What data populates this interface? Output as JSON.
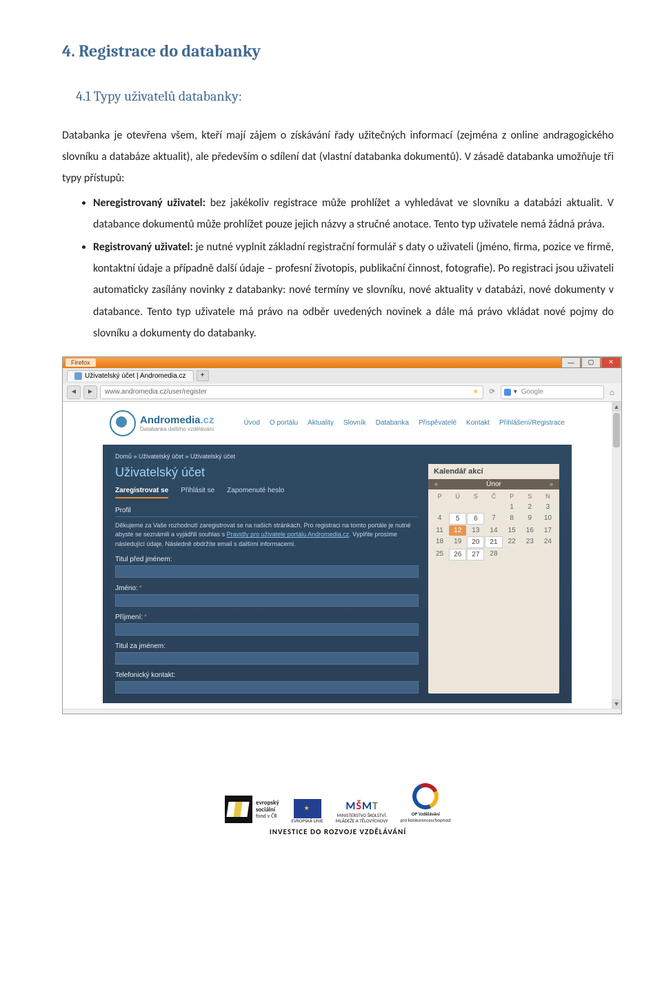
{
  "doc": {
    "h1": "4. Registrace do databanky",
    "h2": "4.1 Typy uživatelů databanky:",
    "intro": "Databanka je otevřena všem, kteří mají zájem o získávání řady užitečných informací (zejména z online andragogického slovníku a databáze aktualit), ale především o sdílení dat (vlastní databanka dokumentů). V zásadě databanka umožňuje tři typy přístupů:",
    "bullets": [
      {
        "bold": "Neregistrovaný uživatel:",
        "text": " bez jakékoliv registrace může prohlížet a vyhledávat ve slovníku a databázi aktualit. V databance dokumentů může prohlížet pouze jejich názvy a stručné anotace. Tento typ uživatele nemá žádná práva."
      },
      {
        "bold": "Registrovaný uživatel:",
        "text": " je nutné vyplnit základní registrační formulář s daty o uživateli (jméno, firma, pozice ve firmě, kontaktní údaje a případně další údaje – profesní životopis, publikační činnost, fotografie). Po registraci jsou uživateli automaticky zasílány novinky z databanky: nové termíny ve slovníku, nové aktuality v databázi, nové dokumenty v databance. Tento typ uživatele má právo na odběr uvedených novinek a dále má právo vkládat nové pojmy do slovníku a dokumenty do databanky."
      }
    ]
  },
  "win": {
    "firefox": "Firefox",
    "tab_title": "Uživatelský účet | Andromedia.cz",
    "url": "www.andromedia.cz/user/register",
    "search_placeholder": "Google",
    "brand_main": "Andromedia",
    "brand_suffix": ".cz",
    "brand_sub": "Databanka dalšího vzdělávání",
    "nav": [
      "Úvod",
      "O portálu",
      "Aktuality",
      "Slovník",
      "Databanka",
      "Přispěvatelé",
      "Kontakt",
      "Přihlášení/Registrace"
    ],
    "breadcrumb": "Domů » Uživatelský účet » Uživatelský účet",
    "page_title": "Uživatelský účet",
    "tabs": {
      "register": "Zaregistrovat se",
      "login": "Přihlásit se",
      "forgot": "Zapomenuté heslo"
    },
    "section_profile": "Profil",
    "para1a": "Děkujeme za Vaše rozhodnutí zaregistrovat se na našich stránkách. Pro registraci na tomto portále je nutné abyste se seznámili a vyjádřili souhlas s ",
    "para1link": "Pravidly pro uživatele portálu Andromedia.cz",
    "para1b": ". Vyplňte prosíme následující údaje. Následně obdržíte email s dalšími informacemi.",
    "fields": {
      "titul_pred": "Titul před jménem:",
      "jmeno": "Jméno:",
      "prijmeni": "Příjmení:",
      "titul_za": "Titul za jménem:",
      "telefon": "Telefonický kontakt:"
    }
  },
  "cal": {
    "title": "Kalendář akcí",
    "month": "Únor",
    "days": [
      "P",
      "Ú",
      "S",
      "Č",
      "P",
      "S",
      "N"
    ],
    "rows": [
      [
        "",
        "",
        "",
        "",
        "1",
        "2",
        "3"
      ],
      [
        "4",
        "5",
        "6",
        "7",
        "8",
        "9",
        "10"
      ],
      [
        "11",
        "12",
        "13",
        "14",
        "15",
        "16",
        "17"
      ],
      [
        "18",
        "19",
        "20",
        "21",
        "22",
        "23",
        "24"
      ],
      [
        "25",
        "26",
        "27",
        "28",
        "",
        "",
        ""
      ]
    ],
    "highlight": "12",
    "boxed": [
      "5",
      "6",
      "20",
      "21",
      "26",
      "27"
    ]
  },
  "footer": {
    "esf1": "evropský",
    "esf2": "sociální",
    "esf3": "fond v ČR",
    "eu": "EVROPSKÁ UNIE",
    "msmt1": "MINISTERSTVO ŠKOLSTVÍ,",
    "msmt2": "MLÁDEŽE A TĚLOVÝCHOVY",
    "opvk1": "OP Vzdělávání",
    "opvk2": "pro konkurenceschopnost",
    "motto": "INVESTICE DO ROZVOJE VZDĚLÁVÁNÍ"
  }
}
